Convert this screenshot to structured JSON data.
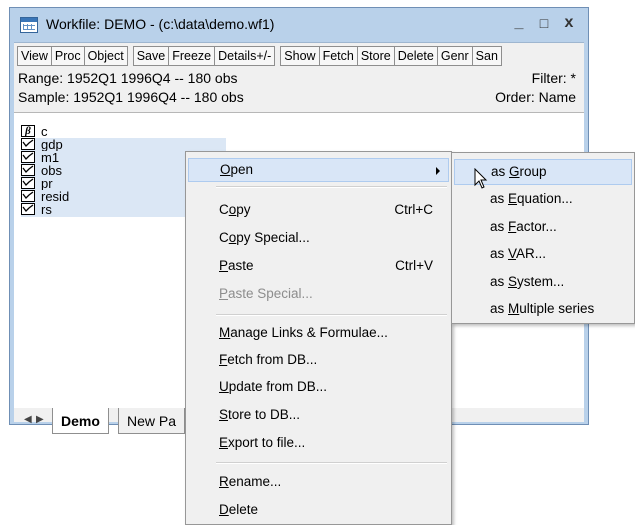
{
  "window": {
    "title": "Workfile: DEMO - (c:\\data\\demo.wf1)",
    "minimize": "_",
    "maximize": "□",
    "close": "x"
  },
  "toolbar": {
    "groups": [
      [
        "View",
        "Proc",
        "Object"
      ],
      [
        "Save",
        "Freeze",
        "Details+/-"
      ],
      [
        "Show",
        "Fetch",
        "Store",
        "Delete",
        "Genr",
        "San"
      ]
    ]
  },
  "info": {
    "range": "Range:  1952Q1 1996Q4  --  180 obs",
    "sample": "Sample: 1952Q1 1996Q4  --  180 obs",
    "filter": "Filter: *",
    "order": "Order: Name"
  },
  "objects": [
    {
      "name": "c",
      "type": "coef",
      "selected": false
    },
    {
      "name": "gdp",
      "type": "series",
      "selected": true
    },
    {
      "name": "m1",
      "type": "series",
      "selected": true
    },
    {
      "name": "obs",
      "type": "series",
      "selected": true
    },
    {
      "name": "pr",
      "type": "series",
      "selected": true
    },
    {
      "name": "resid",
      "type": "series",
      "selected": true
    },
    {
      "name": "rs",
      "type": "series",
      "selected": true
    }
  ],
  "coef_symbol": "β",
  "tabs": {
    "nav_left": "◀",
    "nav_right": "▶",
    "items": [
      "Demo",
      "New Pa"
    ]
  },
  "context_menu": {
    "open": {
      "pre": "",
      "key": "O",
      "post": "pen"
    },
    "copy": {
      "pre": "C",
      "key": "o",
      "post": "py",
      "shortcut": "Ctrl+C"
    },
    "copy_special": {
      "pre": "C",
      "key": "o",
      "post": "py Special..."
    },
    "paste": {
      "pre": "",
      "key": "P",
      "post": "aste",
      "shortcut": "Ctrl+V"
    },
    "paste_special": {
      "pre": "",
      "key": "P",
      "post": "aste Special..."
    },
    "manage_links": {
      "pre": "",
      "key": "M",
      "post": "anage Links & Formulae..."
    },
    "fetch_db": {
      "pre": "",
      "key": "F",
      "post": "etch from DB..."
    },
    "update_db": {
      "pre": "",
      "key": "U",
      "post": "pdate from DB..."
    },
    "store_db": {
      "pre": "",
      "key": "S",
      "post": "tore to DB..."
    },
    "export": {
      "pre": "",
      "key": "E",
      "post": "xport to file..."
    },
    "rename": {
      "pre": "",
      "key": "R",
      "post": "ename..."
    },
    "delete": {
      "pre": "",
      "key": "D",
      "post": "elete"
    }
  },
  "submenu": {
    "group": {
      "pre": "as ",
      "key": "G",
      "post": "roup"
    },
    "equation": {
      "pre": "as ",
      "key": "E",
      "post": "quation..."
    },
    "factor": {
      "pre": "as ",
      "key": "F",
      "post": "actor..."
    },
    "var": {
      "pre": "as ",
      "key": "V",
      "post": "AR..."
    },
    "system": {
      "pre": "as ",
      "key": "S",
      "post": "ystem..."
    },
    "multiple": {
      "pre": "as ",
      "key": "M",
      "post": "ultiple series"
    }
  },
  "colors": {
    "window_frame": "#b9d1ea",
    "selection": "#dbe7f5",
    "menu_highlight": "#d9e6f7",
    "menu_bg": "#f0f0f0"
  }
}
